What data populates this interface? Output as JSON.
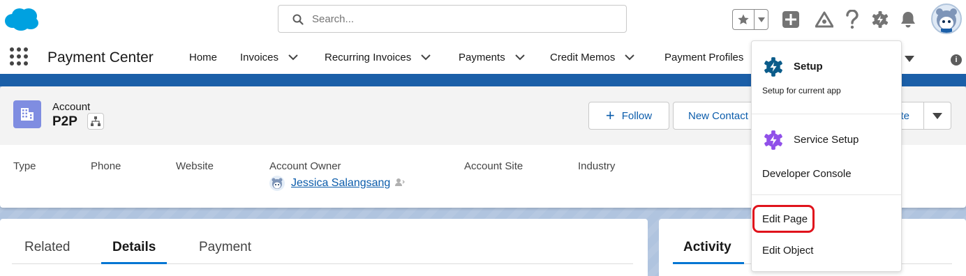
{
  "header": {
    "search_placeholder": "Search...",
    "icons": [
      "salesforce-cloud-logo",
      "search-icon",
      "star-icon",
      "chevron-down-icon",
      "add-icon",
      "trailhead-icon",
      "help-icon",
      "gear-icon",
      "bell-icon",
      "user-avatar"
    ]
  },
  "nav": {
    "app_name": "Payment Center",
    "items": [
      {
        "label": "Home",
        "has_menu": false
      },
      {
        "label": "Invoices",
        "has_menu": true
      },
      {
        "label": "Recurring Invoices",
        "has_menu": true
      },
      {
        "label": "Payments",
        "has_menu": true
      },
      {
        "label": "Credit Memos",
        "has_menu": true
      },
      {
        "label": "Payment Profiles",
        "has_menu": false
      }
    ]
  },
  "record": {
    "object_label": "Account",
    "name": "P2P",
    "actions": {
      "follow": "Follow",
      "new_contact": "New Contact",
      "partial": "te"
    },
    "fields": [
      {
        "label": "Type"
      },
      {
        "label": "Phone"
      },
      {
        "label": "Website"
      },
      {
        "label": "Account Owner",
        "value": "Jessica Salangsang"
      },
      {
        "label": "Account Site"
      },
      {
        "label": "Industry"
      }
    ]
  },
  "tabs": {
    "left": [
      "Related",
      "Details",
      "Payment"
    ],
    "left_active": "Details",
    "right": [
      "Activity"
    ],
    "right_active": "Activity"
  },
  "setup_menu": {
    "title": "Setup",
    "subtitle": "Setup for current app",
    "items": [
      "Service Setup",
      "Developer Console",
      "Edit Page",
      "Edit Object"
    ],
    "highlighted": "Edit Page"
  },
  "colors": {
    "brand_blue": "#0176d3",
    "link_blue": "#0b5cab",
    "gear_teal": "#0b5c8a",
    "service_purple": "#9050e9",
    "highlight_red": "#e0131c"
  }
}
